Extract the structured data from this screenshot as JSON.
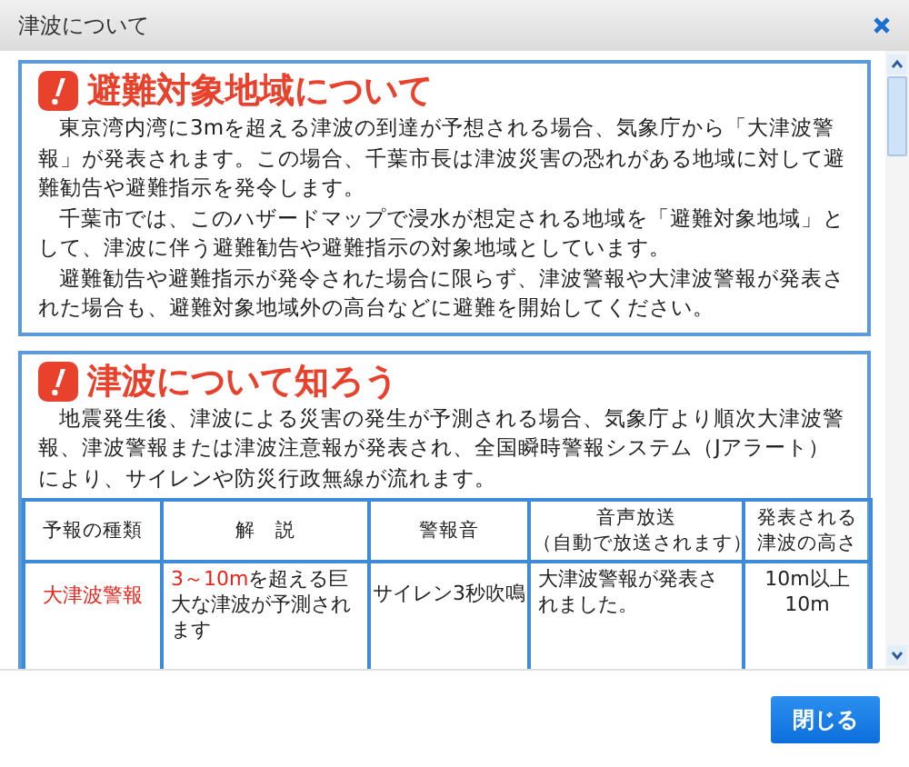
{
  "window": {
    "title": "津波について"
  },
  "sections": [
    {
      "heading": "避難対象地域について",
      "paragraphs": [
        "東京湾内湾に3mを超える津波の到達が予想される場合、気象庁から「大津波警報」が発表されます。この場合、千葉市長は津波災害の恐れがある地域に対して避難勧告や避難指示を発令します。",
        "千葉市では、このハザードマップで浸水が想定される地域を「避難対象地域」として、津波に伴う避難勧告や避難指示の対象地域としています。",
        "避難勧告や避難指示が発令された場合に限らず、津波警報や大津波警報が発表された場合も、避難対象地域外の高台などに避難を開始してください。"
      ]
    },
    {
      "heading": "津波について知ろう",
      "paragraphs": [
        "地震発生後、津波による災害の発生が予測される場合、気象庁より順次大津波警報、津波警報または津波注意報が発表され、全国瞬時警報システム（Jアラート）により、サイレンや防災行政無線が流れます。"
      ],
      "table": {
        "columns": [
          [
            "予報の種類"
          ],
          [
            "解　説"
          ],
          [
            "警報音"
          ],
          [
            "音声放送",
            "（自動で放送されます）"
          ],
          [
            "発表される",
            "津波の高さ"
          ]
        ],
        "rows": [
          {
            "type": "大津波警報",
            "explanation": {
              "emphasis": "3～10m",
              "text": "を超える巨大な津波が予測されます"
            },
            "siren": "サイレン3秒吹鳴",
            "broadcast": "大津波警報が発表されました。",
            "height": [
              "10m以上",
              "10m"
            ]
          }
        ]
      }
    }
  ],
  "buttons": [
    {
      "label": "閉じる"
    }
  ]
}
